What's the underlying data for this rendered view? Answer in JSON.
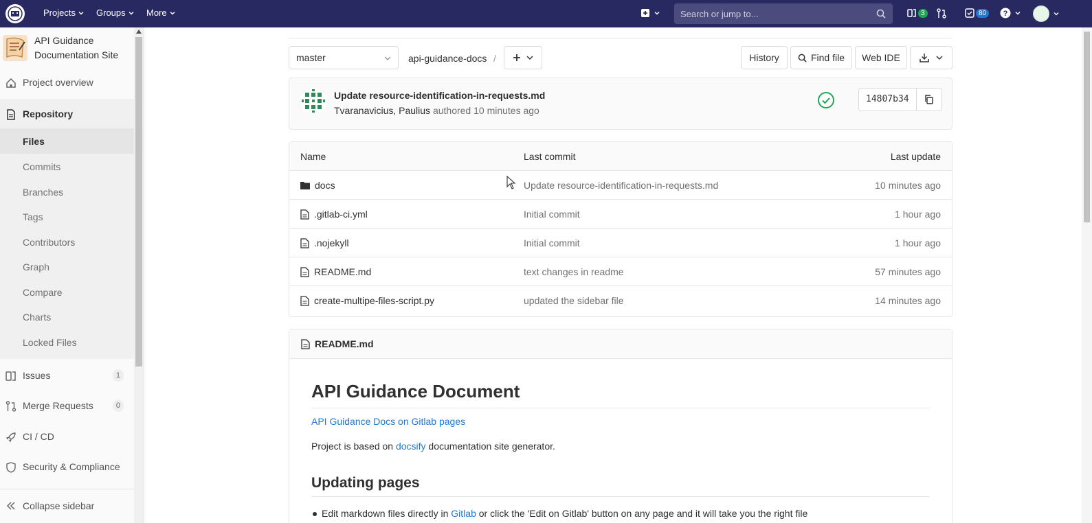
{
  "topnav": {
    "projects_label": "Projects",
    "groups_label": "Groups",
    "more_label": "More",
    "search_placeholder": "Search or jump to...",
    "issues_badge": "3",
    "todos_badge": "80"
  },
  "sidebar": {
    "project_name": "API Guidance Documentation Site",
    "project_overview": "Project overview",
    "repository": "Repository",
    "repo_items": [
      "Files",
      "Commits",
      "Branches",
      "Tags",
      "Contributors",
      "Graph",
      "Compare",
      "Charts",
      "Locked Files"
    ],
    "issues": "Issues",
    "issues_count": "1",
    "merge_requests": "Merge Requests",
    "merge_requests_count": "0",
    "cicd": "CI / CD",
    "security": "Security & Compliance",
    "collapse": "Collapse sidebar"
  },
  "toolbar": {
    "branch": "master",
    "path": "api-guidance-docs",
    "separator": "/",
    "history": "History",
    "find_file": "Find file",
    "web_ide": "Web IDE"
  },
  "commit": {
    "title": "Update resource-identification-in-requests.md",
    "author": "Tvaranavicius, Paulius",
    "meta": "authored 10 minutes ago",
    "sha": "14807b34"
  },
  "tree": {
    "headers": {
      "name": "Name",
      "last_commit": "Last commit",
      "last_update": "Last update"
    },
    "rows": [
      {
        "name": "docs",
        "commit": "Update resource-identification-in-requests.md",
        "updated": "10 minutes ago",
        "type": "folder"
      },
      {
        "name": ".gitlab-ci.yml",
        "commit": "Initial commit",
        "updated": "1 hour ago",
        "type": "file"
      },
      {
        "name": ".nojekyll",
        "commit": "Initial commit",
        "updated": "1 hour ago",
        "type": "file"
      },
      {
        "name": "README.md",
        "commit": "text changes in readme",
        "updated": "57 minutes ago",
        "type": "file"
      },
      {
        "name": "create-multipe-files-script.py",
        "commit": "updated the sidebar file",
        "updated": "14 minutes ago",
        "type": "file"
      }
    ]
  },
  "readme": {
    "filename": "README.md",
    "h1": "API Guidance Document",
    "pages_link": "API Guidance Docs on Gitlab pages",
    "based_pre": "Project is based on ",
    "based_link": "docsify",
    "based_post": " documentation site generator.",
    "h2": "Updating pages",
    "bullet_pre": "Edit markdown files directly in ",
    "bullet_link": "Gitlab",
    "bullet_post": " or click the 'Edit on Gitlab' button on any page and it will take you the right file"
  },
  "colors": {
    "nav_bg": "#292961",
    "link": "#1f78d1",
    "success": "#1aaa55"
  }
}
